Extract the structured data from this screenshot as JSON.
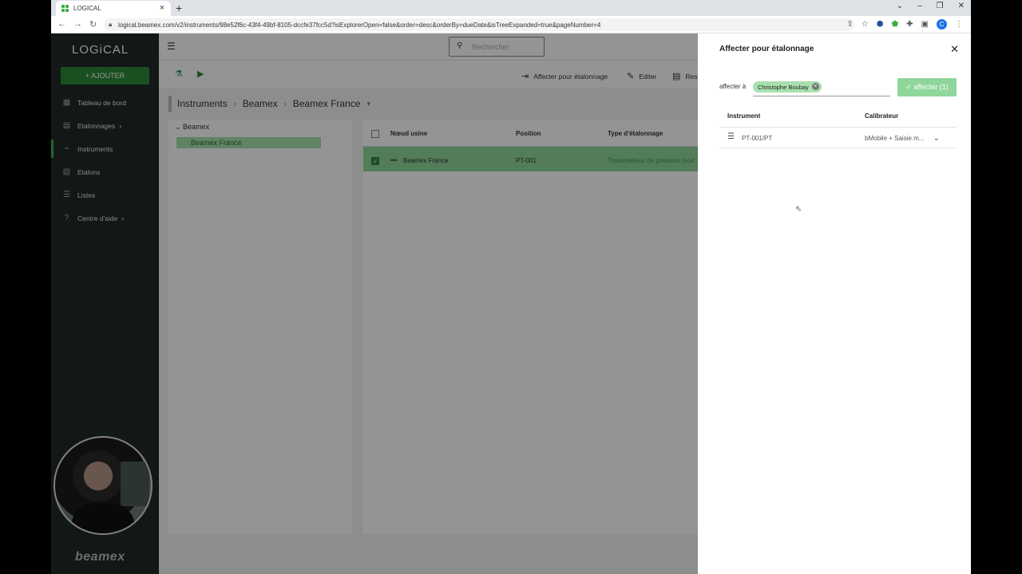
{
  "browser": {
    "tab_title": "LOGICAL",
    "url": "logical.beamex.com/v2/instruments/98e52f6c-43f4-49bf-8105-dccfe37fcc5d?isExplorerOpen=false&order=desc&orderBy=dueDate&isTreeExpanded=true&pageNumber=4",
    "profile_initial": "C"
  },
  "sidebar": {
    "logo": "LOGiCAL",
    "add_label": "AJOUTER",
    "items": [
      {
        "label": "Tableau de bord",
        "icon": "dashboard-icon"
      },
      {
        "label": "Etalonnages",
        "icon": "calibration-icon"
      },
      {
        "label": "Instruments",
        "icon": "instruments-icon"
      },
      {
        "label": "Etalons",
        "icon": "standards-icon"
      },
      {
        "label": "Listes",
        "icon": "list-icon"
      },
      {
        "label": "Centre d'aide",
        "icon": "help-icon"
      }
    ],
    "footer_logo": "beamex"
  },
  "header": {
    "search_placeholder": "Rechercher"
  },
  "toolbar": {
    "assign_label": "Affecter pour étalonnage",
    "edit_label": "Editer",
    "third_label": "Res"
  },
  "breadcrumb": {
    "items": [
      "Instruments",
      "Beamex",
      "Beamex France"
    ]
  },
  "tree": {
    "root": "Beamex",
    "selected": "Beamex France"
  },
  "grid": {
    "columns": [
      "Nœud usine",
      "Position",
      "Type d'étalonnage"
    ],
    "rows": [
      {
        "node": "Beamex France",
        "position": "PT-001",
        "type": "Transmetteur de pression (sort"
      }
    ]
  },
  "panel": {
    "title": "Affecter pour étalonnage",
    "assign_to_label": "affecter à",
    "assignee": "Christophe Boubay",
    "assign_button": "affecter (1)",
    "columns": [
      "Instrument",
      "Calibrateur"
    ],
    "rows": [
      {
        "instrument": "PT-001/PT",
        "calibrator": "bMobile + Saisie m..."
      }
    ]
  },
  "colors": {
    "accent": "#2e8b3a",
    "sidebar_bg": "#1e2a26",
    "chip_bg": "#a8e0ae"
  }
}
